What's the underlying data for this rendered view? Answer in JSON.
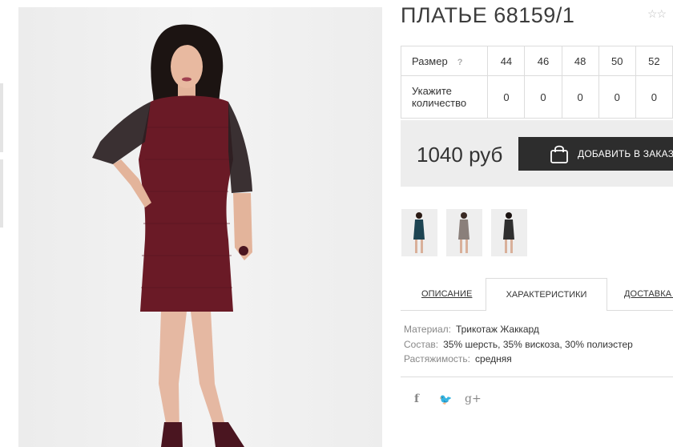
{
  "product": {
    "title": "ПЛАТЬЕ 68159/1",
    "rating_stars": "☆☆"
  },
  "sizes": {
    "header_label": "Размер",
    "help_mark": "?",
    "values": [
      "44",
      "46",
      "48",
      "50",
      "52"
    ],
    "qty_label_line1": "Укажите",
    "qty_label_line2": "количество",
    "quantities": [
      "0",
      "0",
      "0",
      "0",
      "0"
    ]
  },
  "order": {
    "price": "1040 руб",
    "add_label": "ДОБАВИТЬ В ЗАКАЗ"
  },
  "variants": [
    {
      "dress_color": "#1d4452"
    },
    {
      "dress_color": "#8a7f7a"
    },
    {
      "dress_color": "#2f2f2f"
    }
  ],
  "tabs": {
    "description": "ОПИСАНИЕ",
    "characteristics": "ХАРАКТЕРИСТИКИ",
    "delivery": "ДОСТАВКА И"
  },
  "specs": [
    {
      "key": "Материал:",
      "value": "Трикотаж Жаккард"
    },
    {
      "key": "Состав:",
      "value": "35% шерсть, 35% вискоза, 30% полиэстер"
    },
    {
      "key": "Растяжимость:",
      "value": "средняя"
    }
  ],
  "share": {
    "facebook": "f",
    "twitter": "t",
    "googleplus": "g+"
  },
  "colors": {
    "dress": "#6a1a26",
    "button": "#2d2d2d",
    "price_box": "#ededed"
  }
}
